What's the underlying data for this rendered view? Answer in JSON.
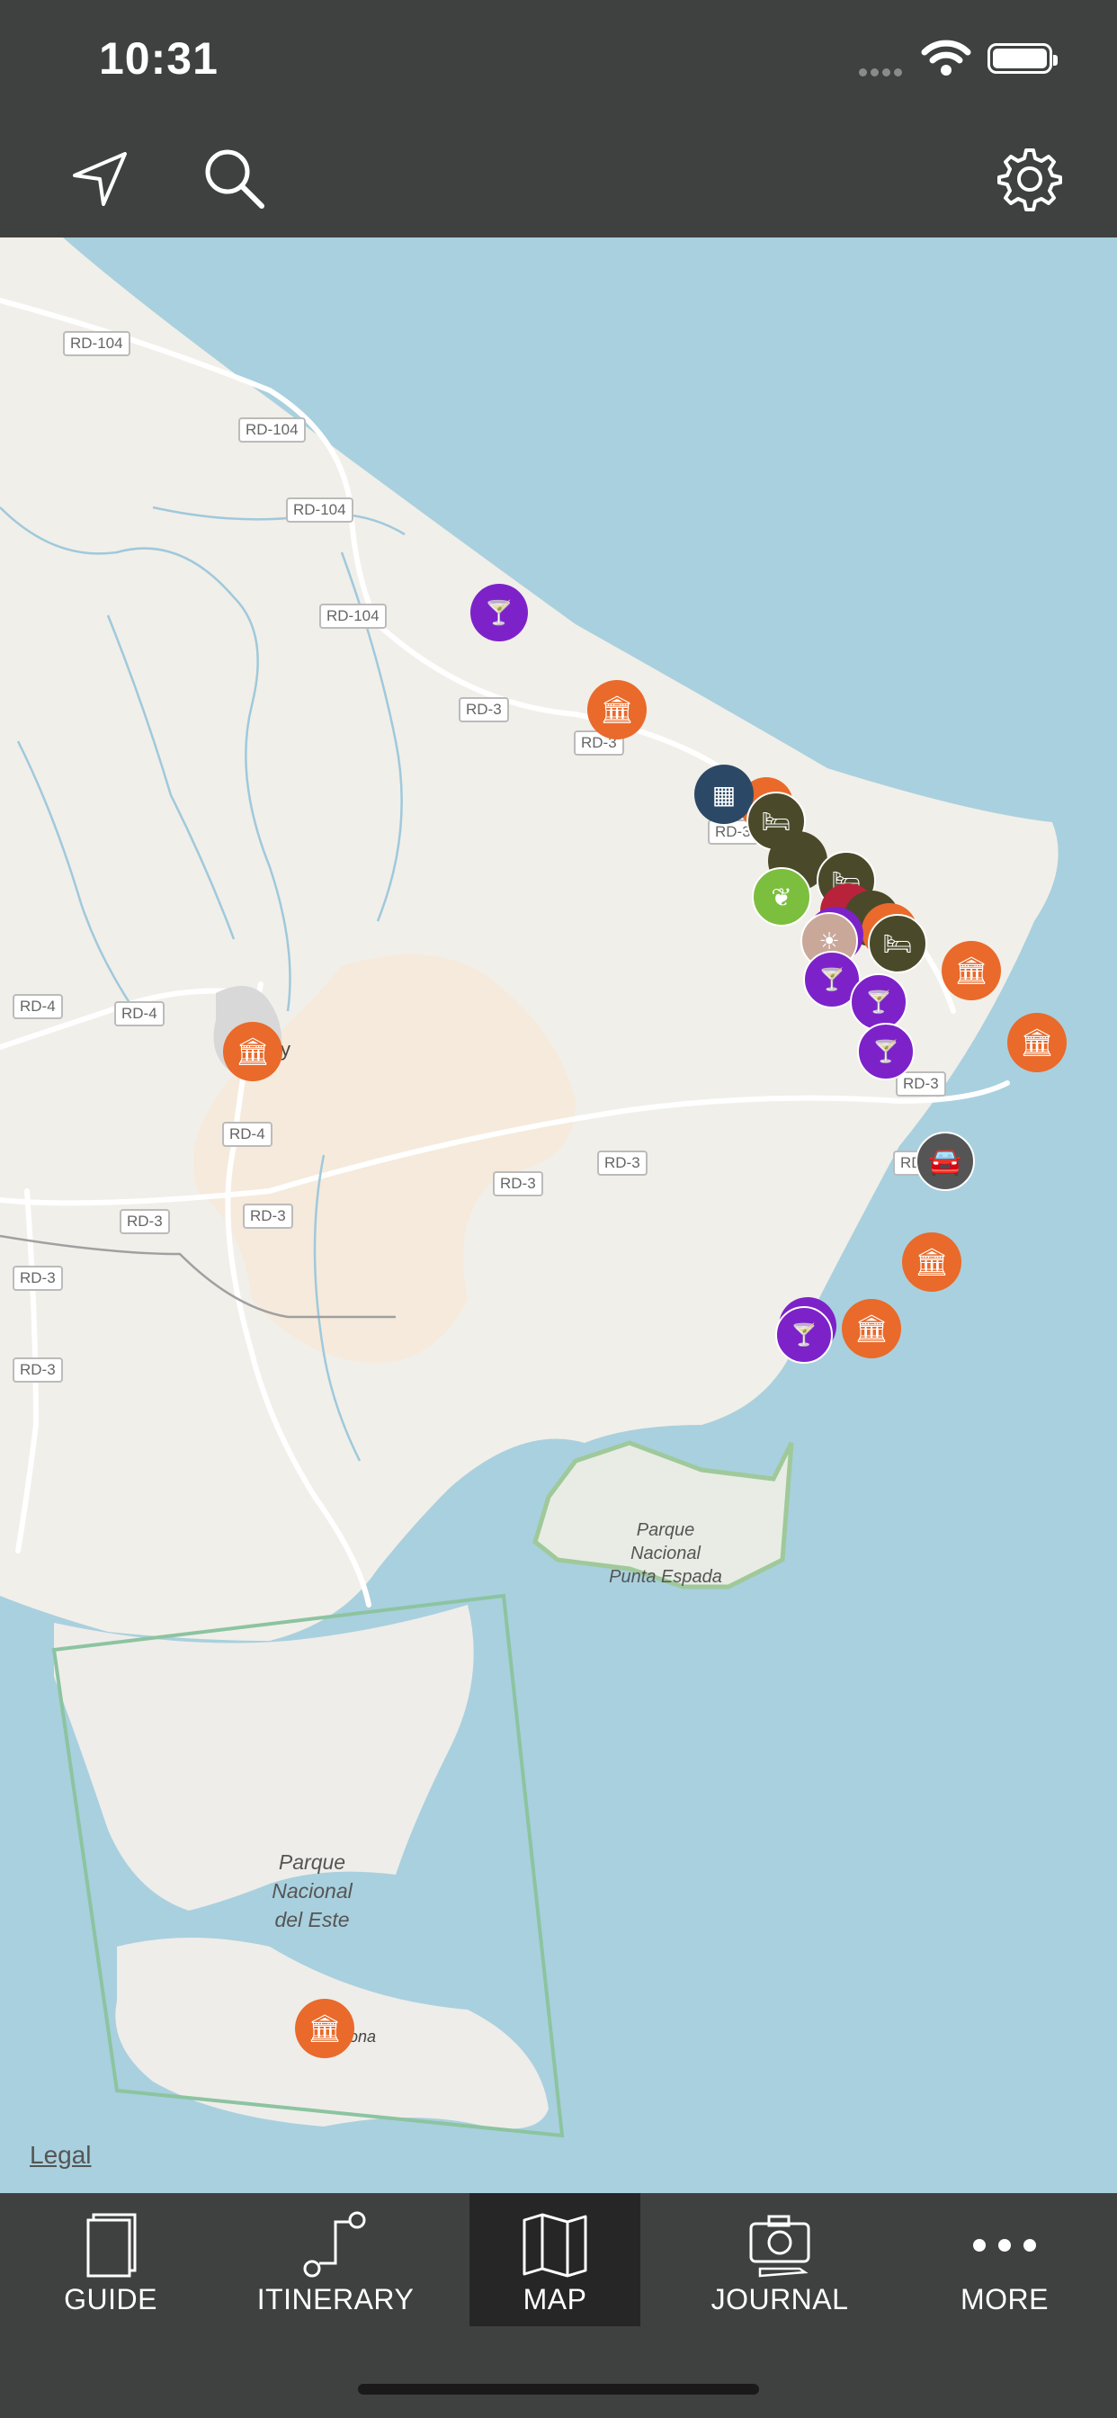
{
  "status": {
    "time": "10:31"
  },
  "toolbar": {
    "locate": "location-arrow-icon",
    "search": "search-icon",
    "settings": "gear-icon"
  },
  "map": {
    "legal": "Legal",
    "road_labels": [
      "RD-104",
      "RD-3",
      "RD-4",
      "RD-3",
      "RD-3"
    ],
    "park_labels": {
      "punta_espada": [
        "Parque",
        "Nacional",
        "Punta Espada"
      ],
      "del_este": [
        "Parque",
        "Nacional",
        "del Este"
      ]
    },
    "place_fragments": [
      "y",
      "ona"
    ],
    "colors": {
      "sea": "#a9d0de",
      "land": "#f1efe9",
      "museum": "#e96a2a",
      "nightlife": "#7d22c9",
      "hotel": "#4a4a2a",
      "calendar": "#2b4966",
      "nature": "#7cbf3f",
      "car": "#555555",
      "food": "#b8233b",
      "beach": "#c9a89a"
    }
  },
  "tabs": [
    {
      "label": "GUIDE",
      "icon": "book-icon"
    },
    {
      "label": "ITINERARY",
      "icon": "route-icon"
    },
    {
      "label": "MAP",
      "icon": "map-icon"
    },
    {
      "label": "JOURNAL",
      "icon": "camera-icon"
    },
    {
      "label": "MORE",
      "icon": "more-dots-icon"
    }
  ]
}
